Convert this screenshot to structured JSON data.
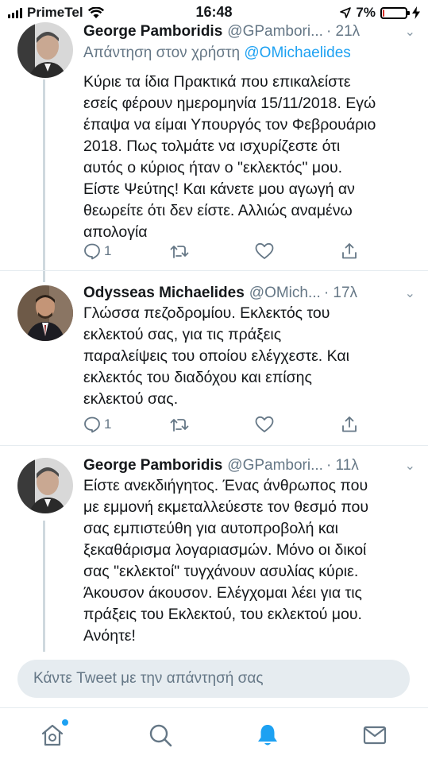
{
  "status_bar": {
    "carrier": "PrimeTel",
    "time": "16:48",
    "battery": "7%",
    "battery_level": 0.07,
    "icons": [
      "signal-icon",
      "wifi-icon",
      "location-icon",
      "battery-icon",
      "charging-icon"
    ]
  },
  "tweets": [
    {
      "name": "George Pamboridis",
      "handle": "@GPambori...",
      "time": "· 21λ",
      "reply_to_prefix": "Απάντηση στον χρήστη",
      "reply_to_user": "@OMichaelides",
      "text": "Κύριε τα ίδια Πρακτικά που επικαλείστε\nεσείς φέρουν ημερομηνία 15/11/2018. Εγώ\nέπαψα να είμαι Υπουργός τον Φεβρουάριο\n2018. Πως τολμάτε να ισχυρίζεστε ότι\nαυτός ο κύριος ήταν ο \"εκλεκτός\" μου.\nΕίστε Ψεύτης! Και κάνετε μου αγωγή αν\nθεωρείτε ότι δεν είστε. Αλλιώς αναμένω\nαπολογία",
      "reply_count": "1"
    },
    {
      "name": "Odysseas Michaelides",
      "handle": "@OMich...",
      "time": "· 17λ",
      "text": "Γλώσσα πεζοδρομίου.  Εκλεκτός του\nεκλεκτού σας, για τις πράξεις\nπαραλείψεις του οποίου ελέγχεστε. Και\nεκλεκτός του διαδόχου και επίσης\nεκλεκτού σας.",
      "reply_count": "1"
    },
    {
      "name": "George Pamboridis",
      "handle": "@GPambori...",
      "time": "· 11λ",
      "text": "Είστε ανεκδιήγητος. Ένας άνθρωπος που\nμε εμμονή εκμεταλλεύεστε τον θεσμό που\nσας εμπιστεύθη για αυτοπροβολή και\nξεκαθάρισμα λογαριασμών. Μόνο οι δικοί\nσας \"εκλεκτοί\" τυγχάνουν ασυλίας κύριε.\nΆκουσον άκουσον. Ελέγχομαι λέει για τις\nπράξεις του Εκλεκτού, του εκλεκτού μου.\nΑνόητε!"
    }
  ],
  "reply_bar": {
    "placeholder": "Κάντε Tweet με την απάντησή σας"
  },
  "tab_bar": {
    "active": "notifications",
    "accent": "#1da1f2",
    "tabs": [
      "home-icon",
      "search-icon",
      "notifications-icon",
      "messages-icon"
    ]
  },
  "colors": {
    "link": "#1da1f2",
    "secondary_text": "#657786",
    "thread_line": "#cfd9de"
  }
}
